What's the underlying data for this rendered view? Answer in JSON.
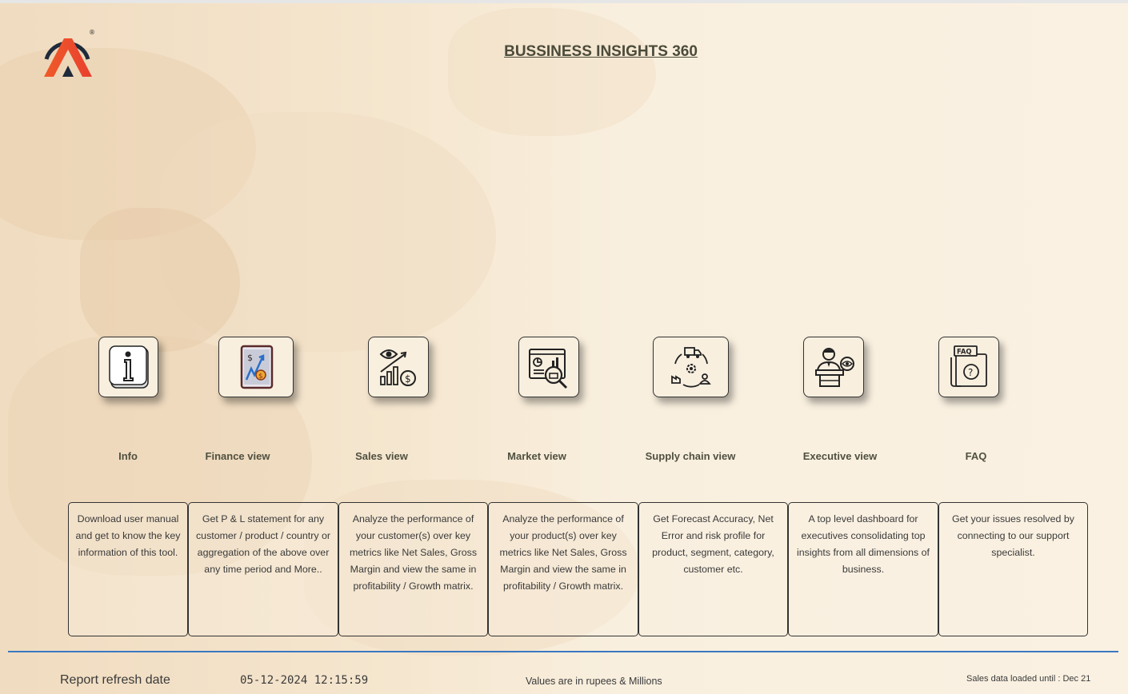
{
  "header": {
    "title": "BUSSINESS INSIGHTS 360",
    "registered_mark": "®"
  },
  "nav": [
    {
      "id": "info",
      "icon": "info-icon",
      "label": "Info",
      "description": "Download user manual and get to know the key information of this tool."
    },
    {
      "id": "finance",
      "icon": "finance-icon",
      "label": "Finance view",
      "description": "Get  P & L statement for any customer / product / country or aggregation of the above over any time period and More.."
    },
    {
      "id": "sales",
      "icon": "sales-icon",
      "label": "Sales view",
      "description": "Analyze the performance of your customer(s) over key metrics like Net Sales, Gross Margin and view the same in profitability / Growth matrix."
    },
    {
      "id": "market",
      "icon": "market-icon",
      "label": "Market view",
      "description": "Analyze the performance of your product(s) over key metrics like Net Sales, Gross Margin and view the same in profitability / Growth matrix."
    },
    {
      "id": "supply",
      "icon": "supply-chain-icon",
      "label": "Supply chain view",
      "description": "Get Forecast Accuracy, Net Error and risk profile for product, segment, category, customer etc."
    },
    {
      "id": "executive",
      "icon": "executive-icon",
      "label": "Executive view",
      "description": "A top level dashboard for executives consolidating top insights from all dimensions of business."
    },
    {
      "id": "faq",
      "icon": "faq-icon",
      "label": "FAQ",
      "description": "Get your issues resolved by connecting to our support specialist.",
      "icon_text": "FAQ"
    }
  ],
  "footer": {
    "refresh_label": "Report refresh date",
    "refresh_value": "05-12-2024 12:15:59",
    "units_note": "Values are in rupees & Millions",
    "sales_loaded": "Sales data loaded until : Dec 21"
  },
  "colors": {
    "accent_line": "#3a78c2",
    "logo_orange": "#f05a28",
    "logo_dark": "#1f2a3a"
  }
}
